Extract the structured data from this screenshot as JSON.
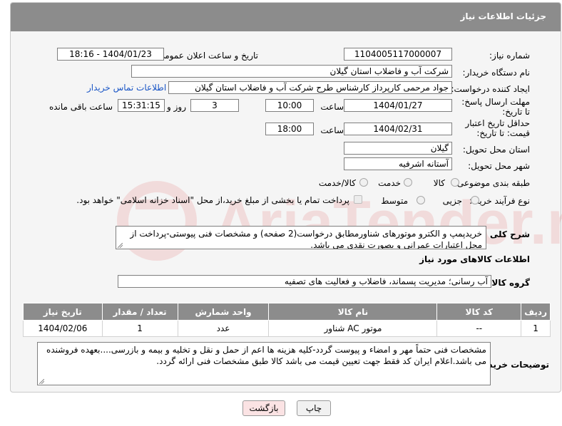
{
  "header": {
    "title": "جزئیات اطلاعات نیاز"
  },
  "fields": {
    "need_number_label": "شماره نیاز:",
    "need_number": "1104005117000007",
    "announce_label": "تاریخ و ساعت اعلان عمومی:",
    "announce_value": "1404/01/23 - 18:16",
    "buyer_org_label": "نام دستگاه خریدار:",
    "buyer_org": "شرکت آب و فاضلاب استان گیلان",
    "requester_label": "ایجاد کننده درخواست:",
    "requester": "جواد مرحمی کارپرداز کارشناس طرح شرکت آب و فاضلاب استان گیلان",
    "contact_link": "اطلاعات تماس خریدار",
    "reply_deadline_label": "مهلت ارسال پاسخ: تا تاریخ:",
    "reply_date": "1404/01/27",
    "time_label_1": "ساعت",
    "reply_time": "10:00",
    "days_value": "3",
    "days_label": "روز و",
    "remaining_value": "15:31:15",
    "remaining_label": "ساعت باقی مانده",
    "price_validity_label": "حداقل تاریخ اعتبار قیمت: تا تاریخ:",
    "price_date": "1404/02/31",
    "time_label_2": "ساعت",
    "price_time": "18:00",
    "province_label": "استان محل تحویل:",
    "province": "گیلان",
    "city_label": "شهر محل تحویل:",
    "city": "آستانه اشرفیه",
    "category_label": "طبقه بندی موضوعی:",
    "category_options": [
      "کالا",
      "خدمت",
      "کالا/خدمت"
    ],
    "process_label": "نوع فرآیند خرید :",
    "process_options": [
      "جزیی",
      "متوسط"
    ],
    "payment_note": "پرداخت تمام یا بخشی از مبلغ خرید،از محل \"اسناد خزانه اسلامی\" خواهد بود.",
    "description_label": "شرح کلی نیاز:",
    "description": "خریدپمپ و الکترو موتورهای شناورمطابق درخواست(2 صفحه) و مشخصات فنی پیوستی-پرداخت از محل اعتبارات عمرانی و بصورت نقدی می باشد.",
    "goods_info_title": "اطلاعات کالاهای مورد نیاز",
    "goods_group_label": "گروه کالا:",
    "goods_group": "آب رسانی؛ مدیریت پسماند، فاضلاب و فعالیت های تصفیه"
  },
  "table": {
    "headers": [
      "ردیف",
      "کد کالا",
      "نام کالا",
      "واحد شمارش",
      "تعداد / مقدار",
      "تاریخ نیاز"
    ],
    "rows": [
      [
        "1",
        "--",
        "موتور AC شناور",
        "عدد",
        "1",
        "1404/02/06"
      ]
    ]
  },
  "buyer_notes_label": "توضیحات خریدار:",
  "buyer_notes": "مشخصات فنی حتماً مهر و امضاء و پیوست گردد-کلیه هزینه ها اعم از حمل و نقل و تخلیه و بیمه و بازرسی....بعهده فروشنده می باشد.اعلام ایران کد فقط جهت تعیین قیمت می باشد کالا طبق مشخصات فنی ارائه گردد.",
  "buttons": {
    "print": "چاپ",
    "back": "بازگشت"
  },
  "colors": {
    "header_bg": "#8c8c8c",
    "link": "#1a56c6",
    "back_btn": "#fbe3e4"
  }
}
